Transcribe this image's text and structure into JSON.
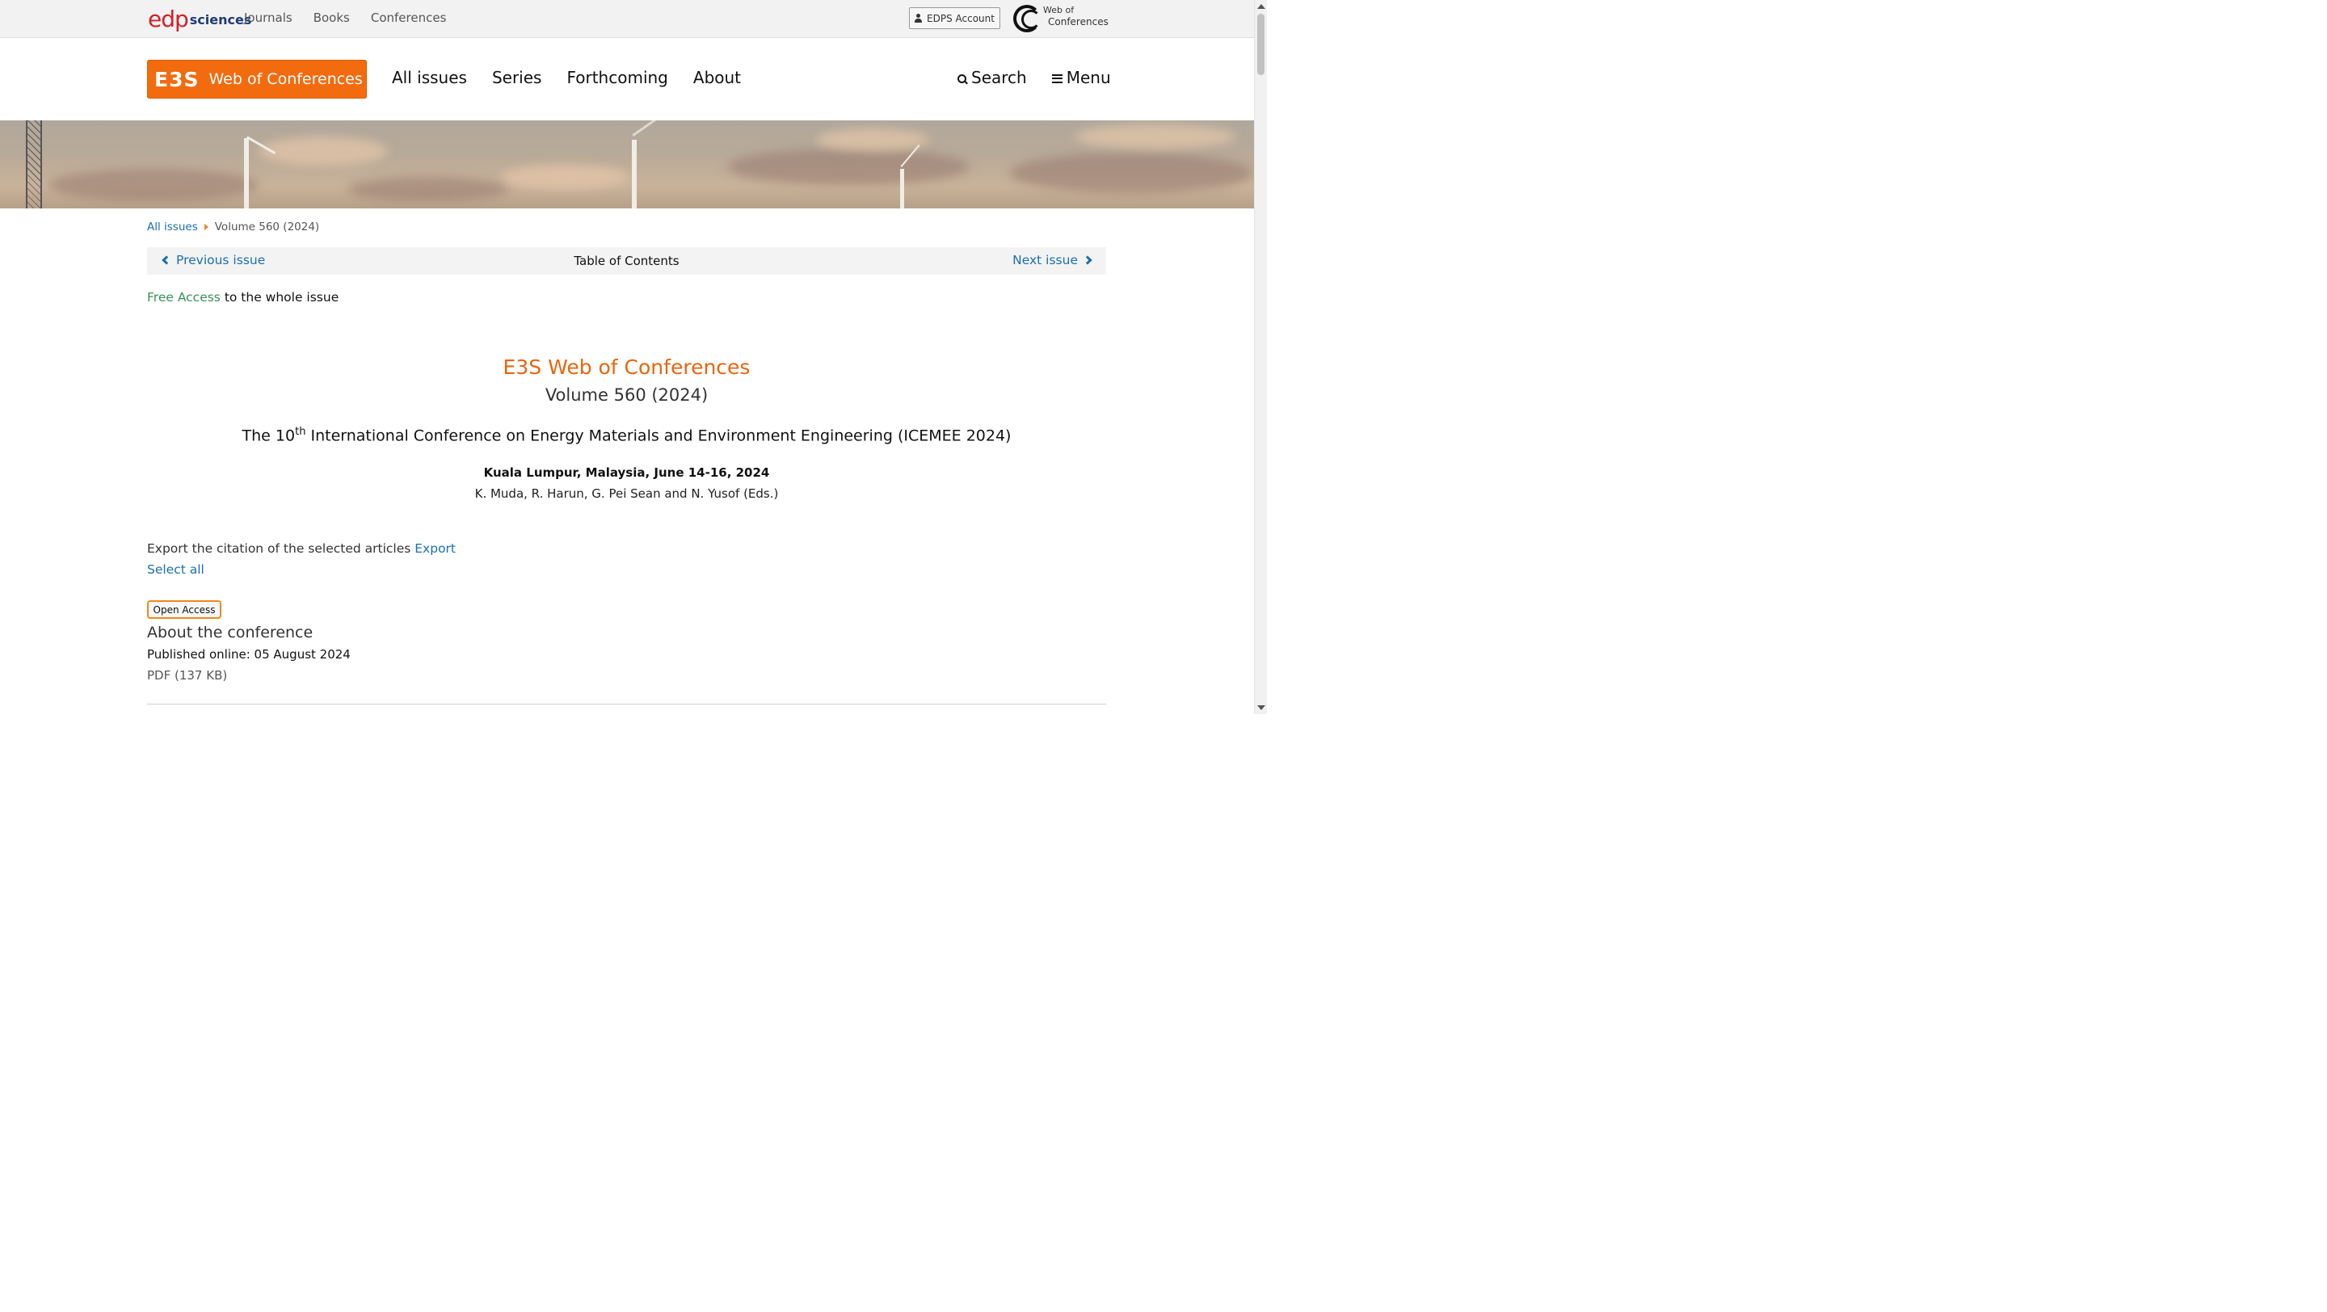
{
  "topbar": {
    "brand_edp": "edp",
    "brand_sciences": "sciences",
    "links": [
      "Journals",
      "Books",
      "Conferences"
    ],
    "account_label": "EDPS Account",
    "wol_line1": "Web of",
    "wol_line2": "Conferences"
  },
  "header": {
    "logo_e3s": "E3S",
    "logo_text": "Web of Conferences",
    "nav": [
      "All issues",
      "Series",
      "Forthcoming",
      "About"
    ],
    "search_label": "Search",
    "menu_label": "Menu"
  },
  "breadcrumb": {
    "root": "All issues",
    "current": "Volume 560 (2024)"
  },
  "toc_bar": {
    "previous": "Previous issue",
    "title": "Table of Contents",
    "next": "Next issue"
  },
  "access": {
    "free_label": "Free Access",
    "suffix": " to the whole issue"
  },
  "issue": {
    "journal": "E3S Web of Conferences",
    "volume": "Volume 560 (2024)",
    "conf_prefix": "The 10",
    "conf_sup": "th",
    "conf_suffix": " International Conference on Energy Materials and Environment Engineering (ICEMEE 2024)",
    "location": "Kuala Lumpur, Malaysia, June 14-16, 2024",
    "editors": "K. Muda, R. Harun, G. Pei Sean and N. Yusof (Eds.)"
  },
  "tools": {
    "export_text": "Export the citation of the selected articles ",
    "export_link": "Export",
    "select_all": "Select all"
  },
  "article": {
    "badge": "Open Access",
    "title": "About the conference",
    "published": "Published online: 05 August 2024",
    "pdf": "PDF (137 KB)"
  },
  "colors": {
    "accent_orange": "#f26b0f",
    "link_blue": "#1a6fb0",
    "free_green": "#3a8f5a"
  }
}
